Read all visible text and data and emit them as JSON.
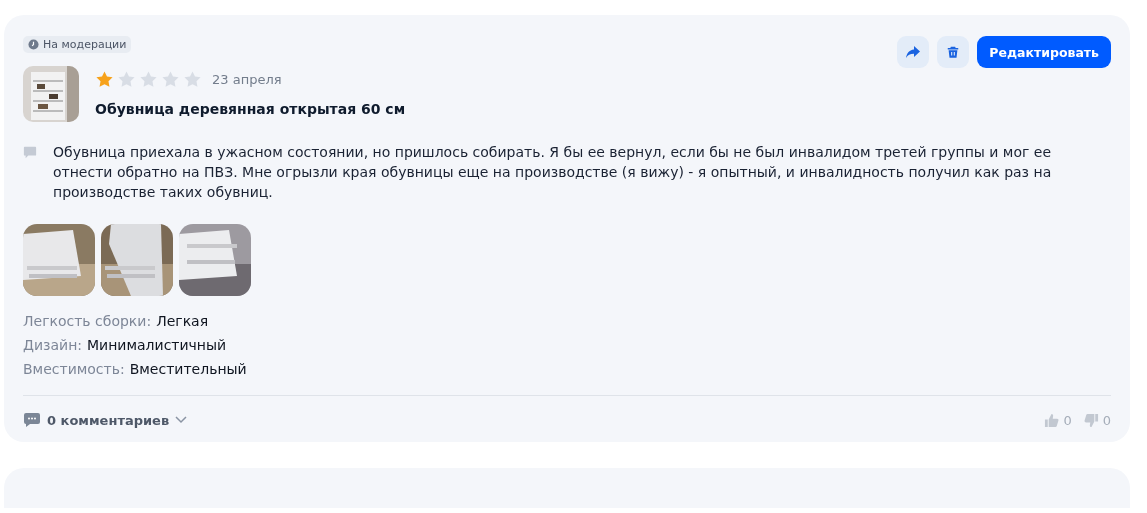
{
  "status_badge": {
    "label": "На модерации"
  },
  "actions": {
    "edit_button": "Редактировать"
  },
  "review": {
    "stars": 1,
    "date": "23 апреля",
    "product_title": "Обувница деревянная открытая 60 см",
    "text": "Обувница приехала в ужасном состоянии, но пришлось собирать. Я бы ее вернул, если бы не был инвалидом третей группы и мог ее отнести обратно на ПВЗ. Мне огрызли края обувницы еще на производстве (я вижу) - я опытный, и инвалидность получил как раз на производстве таких обувниц.",
    "photos": [
      {
        "kind": "picture"
      },
      {
        "kind": "picture"
      },
      {
        "kind": "picture"
      }
    ],
    "attributes": [
      {
        "label": "Легкость сборки:",
        "value": "Легкая"
      },
      {
        "label": "Дизайн:",
        "value": "Минималистичный"
      },
      {
        "label": "Вместимость:",
        "value": "Вместительный"
      }
    ]
  },
  "footer": {
    "comments": "0 комментариев",
    "likes": "0",
    "dislikes": "0"
  }
}
